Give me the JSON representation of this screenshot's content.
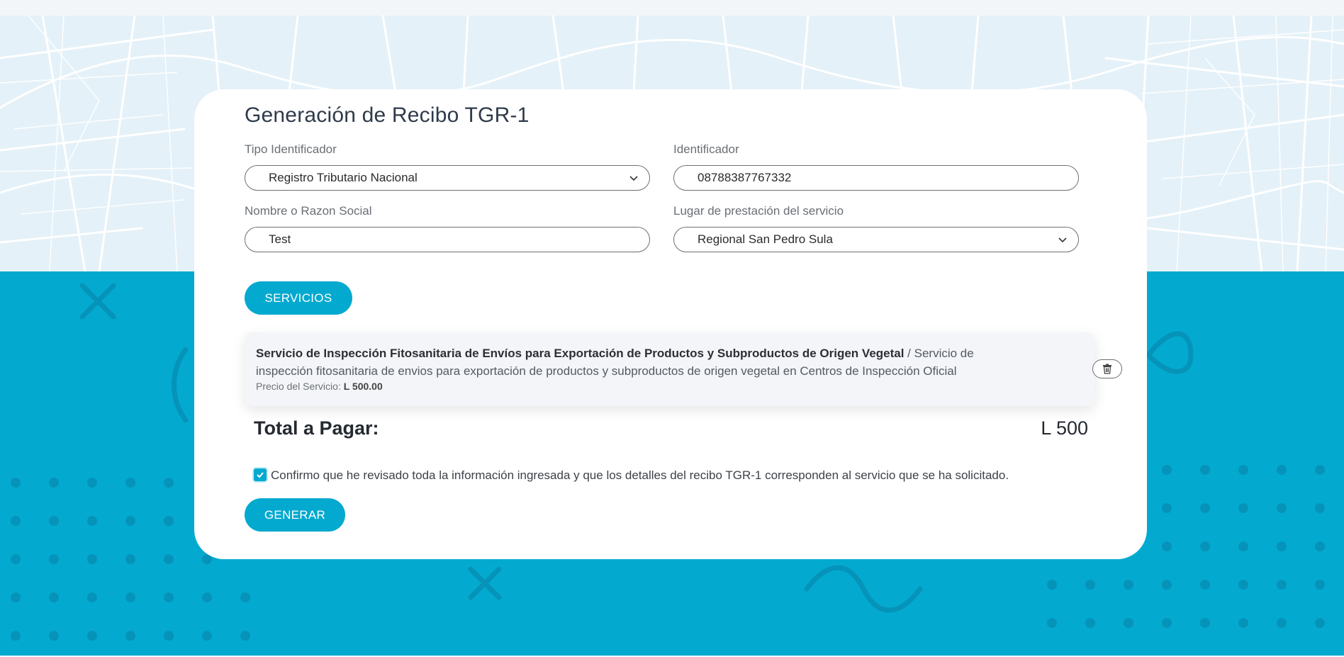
{
  "page": {
    "title": "Generación de Recibo TGR-1"
  },
  "form": {
    "tipo_identificador": {
      "label": "Tipo Identificador",
      "value": "Registro Tributario Nacional"
    },
    "identificador": {
      "label": "Identificador",
      "value": "08788387767332"
    },
    "nombre": {
      "label": "Nombre o Razon Social",
      "value": "Test"
    },
    "lugar": {
      "label": "Lugar de prestación del servicio",
      "value": "Regional San Pedro Sula"
    }
  },
  "buttons": {
    "servicios": "SERVICIOS",
    "generar": "GENERAR"
  },
  "services": [
    {
      "name": "Servicio de Inspección Fitosanitaria de Envíos para Exportación de Productos y Subproductos de Origen Vegetal",
      "separator": " / ",
      "description": "Servicio de inspección fitosanitaria de envios para exportación de productos y subproductos de origen vegetal en Centros de Inspección Oficial",
      "price_label": "Precio del Servicio: ",
      "price": "L 500.00",
      "delete_icon": "trash-icon"
    }
  ],
  "total": {
    "label": "Total a Pagar:",
    "value": "L 500"
  },
  "confirmation": {
    "checked": true,
    "text": "Confirmo que he revisado toda la información ingresada y que los detalles del recibo TGR-1 corresponden al servicio que se ha solicitado."
  },
  "colors": {
    "primary": "#04a9cf",
    "map_background": "#e4f1f8",
    "card": "#ffffff",
    "text_dark": "#2f3a4a"
  }
}
